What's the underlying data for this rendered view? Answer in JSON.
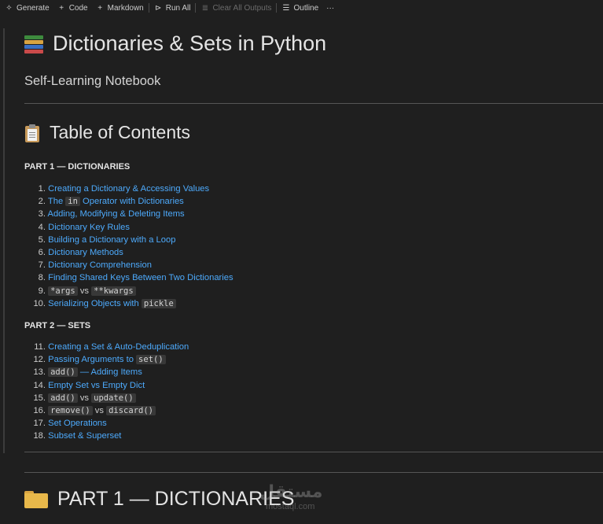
{
  "toolbar": {
    "generate": "Generate",
    "code": "Code",
    "markdown": "Markdown",
    "run_all": "Run All",
    "clear_outputs": "Clear All Outputs",
    "outline": "Outline",
    "more": "···"
  },
  "notebook": {
    "title": "Dictionaries & Sets in Python",
    "subtitle": "Self-Learning Notebook",
    "toc_heading": "Table of Contents",
    "part1_label": "PART 1 — DICTIONARIES",
    "part2_label": "PART 2 — SETS",
    "part1_heading": "PART 1 — DICTIONARIES"
  },
  "toc_part1": [
    {
      "num": "1.",
      "parts": [
        {
          "t": "Creating a Dictionary & Accessing Values"
        }
      ]
    },
    {
      "num": "2.",
      "parts": [
        {
          "t": "The "
        },
        {
          "c": "in"
        },
        {
          "t": " Operator with Dictionaries"
        }
      ]
    },
    {
      "num": "3.",
      "parts": [
        {
          "t": "Adding, Modifying & Deleting Items"
        }
      ]
    },
    {
      "num": "4.",
      "parts": [
        {
          "t": "Dictionary Key Rules"
        }
      ]
    },
    {
      "num": "5.",
      "parts": [
        {
          "t": "Building a Dictionary with a Loop"
        }
      ]
    },
    {
      "num": "6.",
      "parts": [
        {
          "t": "Dictionary Methods"
        }
      ]
    },
    {
      "num": "7.",
      "parts": [
        {
          "t": "Dictionary Comprehension"
        }
      ]
    },
    {
      "num": "8.",
      "parts": [
        {
          "t": "Finding Shared Keys Between Two Dictionaries"
        }
      ]
    },
    {
      "num": "9.",
      "parts": [
        {
          "c": "*args"
        },
        {
          "t": " vs ",
          "v": true
        },
        {
          "c": "**kwargs"
        }
      ]
    },
    {
      "num": "10.",
      "parts": [
        {
          "t": "Serializing Objects with "
        },
        {
          "c": "pickle"
        }
      ]
    }
  ],
  "toc_part2": [
    {
      "num": "11.",
      "parts": [
        {
          "t": "Creating a Set & Auto-Deduplication"
        }
      ]
    },
    {
      "num": "12.",
      "parts": [
        {
          "t": "Passing Arguments to "
        },
        {
          "c": "set()"
        }
      ]
    },
    {
      "num": "13.",
      "parts": [
        {
          "c": "add()"
        },
        {
          "t": " — Adding Items"
        }
      ]
    },
    {
      "num": "14.",
      "parts": [
        {
          "t": "Empty Set vs Empty Dict"
        }
      ]
    },
    {
      "num": "15.",
      "parts": [
        {
          "c": "add()"
        },
        {
          "t": " vs ",
          "v": true
        },
        {
          "c": "update()"
        }
      ]
    },
    {
      "num": "16.",
      "parts": [
        {
          "c": "remove()"
        },
        {
          "t": " vs ",
          "v": true
        },
        {
          "c": "discard()"
        }
      ]
    },
    {
      "num": "17.",
      "parts": [
        {
          "t": "Set Operations"
        }
      ]
    },
    {
      "num": "18.",
      "parts": [
        {
          "t": "Subset & Superset"
        }
      ]
    }
  ],
  "watermark": {
    "arabic": "مستقل",
    "latin": "mostaql.com"
  }
}
